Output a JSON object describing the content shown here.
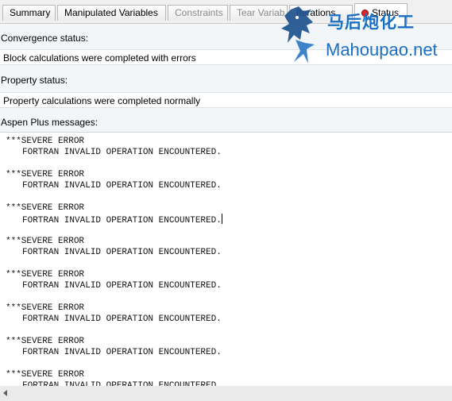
{
  "tabs": [
    {
      "label": "Summary",
      "state": "normal"
    },
    {
      "label": "Manipulated Variables",
      "state": "normal"
    },
    {
      "label": "Constraints",
      "state": "disabled"
    },
    {
      "label": "Tear Variab",
      "state": "disabled"
    },
    {
      "label": "Iterations",
      "state": "normal"
    },
    {
      "label": "Status",
      "state": "active",
      "icon": "error-status-icon",
      "icon_color": "#d9262b"
    }
  ],
  "convergence": {
    "label": "Convergence status:",
    "value": "Block calculations were completed with errors"
  },
  "property": {
    "label": "Property status:",
    "value": "Property calculations were completed normally"
  },
  "messages": {
    "label": "Aspen Plus messages:",
    "items": [
      {
        "line1": "***SEVERE ERROR",
        "line2": "FORTRAN INVALID OPERATION ENCOUNTERED."
      },
      {
        "line1": "***SEVERE ERROR",
        "line2": "FORTRAN INVALID OPERATION ENCOUNTERED."
      },
      {
        "line1": "***SEVERE ERROR",
        "line2": "FORTRAN INVALID OPERATION ENCOUNTERED."
      },
      {
        "line1": "***SEVERE ERROR",
        "line2": "FORTRAN INVALID OPERATION ENCOUNTERED."
      },
      {
        "line1": "***SEVERE ERROR",
        "line2": "FORTRAN INVALID OPERATION ENCOUNTERED."
      },
      {
        "line1": "***SEVERE ERROR",
        "line2": "FORTRAN INVALID OPERATION ENCOUNTERED."
      },
      {
        "line1": "***SEVERE ERROR",
        "line2": "FORTRAN INVALID OPERATION ENCOUNTERED."
      },
      {
        "line1": "***SEVERE ERROR",
        "line2": "FORTRAN INVALID OPERATION ENCOUNTERED."
      }
    ]
  },
  "watermark": {
    "chinese": "马后炮化工",
    "site": "Mahoupao.net",
    "color": "#1b6fc2"
  },
  "colors": {
    "accent": "#1b6fc2",
    "error": "#d9262b"
  }
}
